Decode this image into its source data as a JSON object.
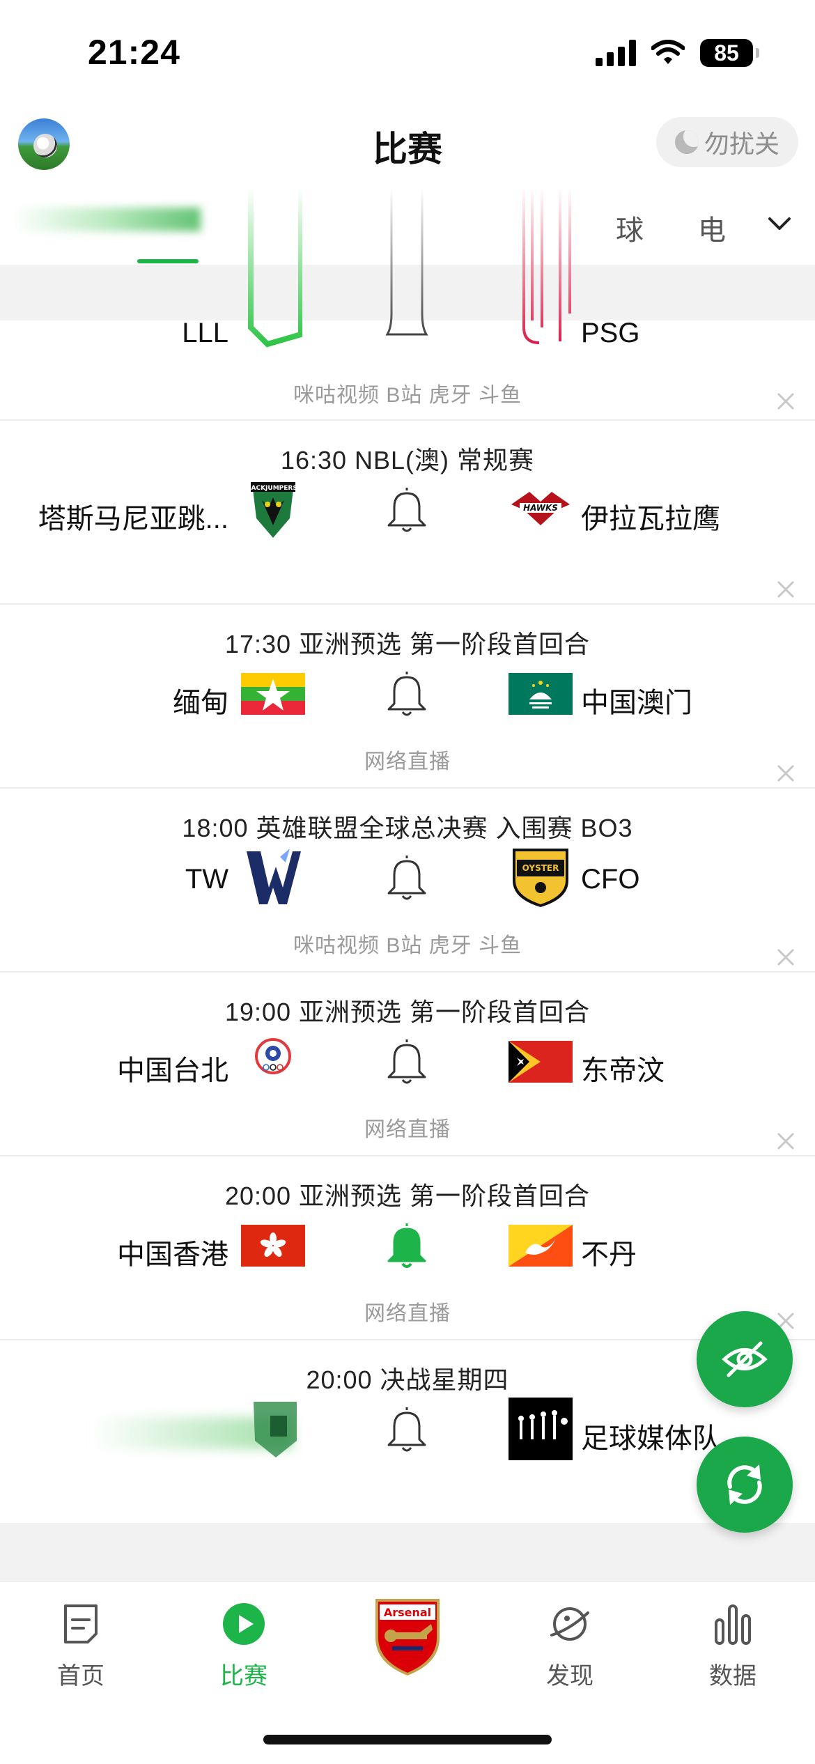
{
  "status_bar": {
    "time": "21:24",
    "battery": "85"
  },
  "header": {
    "title": "比赛",
    "dnd_label": "勿扰关"
  },
  "tabs": {
    "items": [
      "球",
      "电"
    ]
  },
  "partial_match": {
    "home": "LLL",
    "away": "PSG",
    "channels": "咪咕视频 B站 虎牙 斗鱼"
  },
  "matches": [
    {
      "title": "16:30 NBL(澳) 常规赛",
      "home": "塔斯马尼亚跳...",
      "away": "伊拉瓦拉鹰",
      "channels": "",
      "bell_active": false
    },
    {
      "title": "17:30 亚洲预选 第一阶段首回合",
      "home": "缅甸",
      "away": "中国澳门",
      "channels": "网络直播",
      "bell_active": false
    },
    {
      "title": "18:00 英雄联盟全球总决赛 入围赛 BO3",
      "home": "TW",
      "away": "CFO",
      "channels": "咪咕视频 B站 虎牙 斗鱼",
      "bell_active": false
    },
    {
      "title": "19:00 亚洲预选 第一阶段首回合",
      "home": "中国台北",
      "away": "东帝汶",
      "channels": "网络直播",
      "bell_active": false
    },
    {
      "title": "20:00 亚洲预选 第一阶段首回合",
      "home": "中国香港",
      "away": "不丹",
      "channels": "网络直播",
      "bell_active": true
    },
    {
      "title": "20:00 决战星期四",
      "home": "",
      "away": "足球媒体队",
      "channels": "",
      "bell_active": false
    }
  ],
  "bottom_nav": {
    "home": "首页",
    "matches": "比赛",
    "discover": "发现",
    "data": "数据"
  },
  "colors": {
    "accent": "#1db44a",
    "fab": "#1aa84a"
  }
}
